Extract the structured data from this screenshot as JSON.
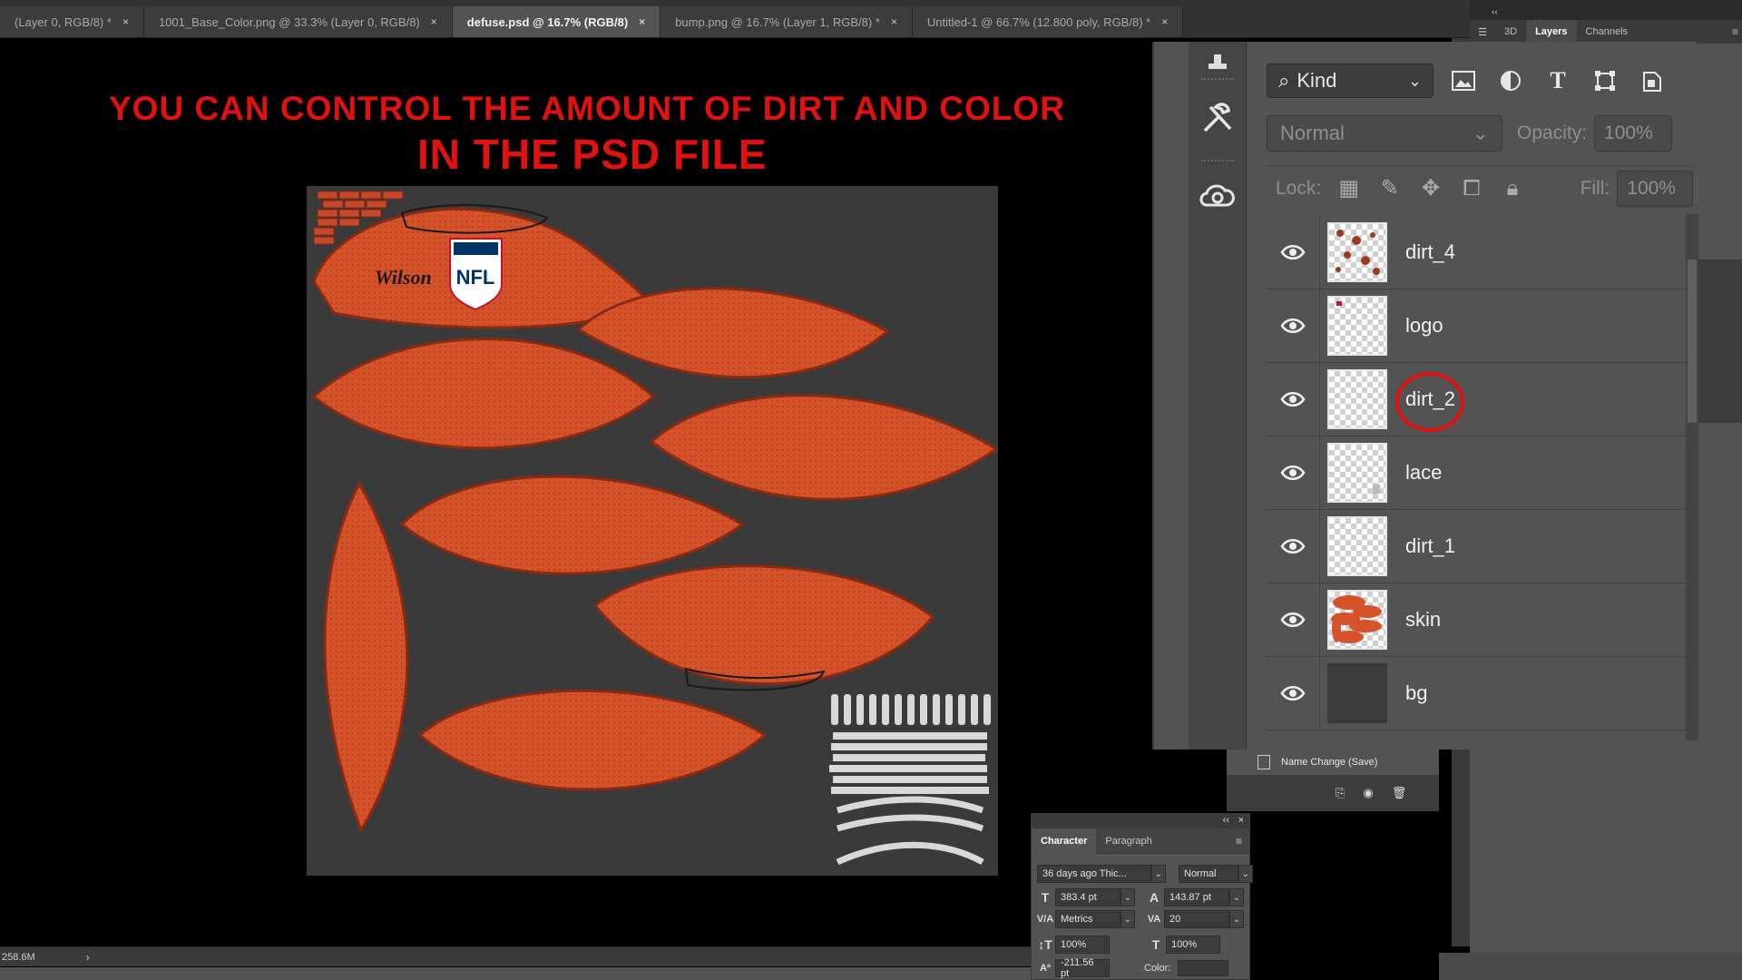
{
  "tabs": [
    {
      "label": "(Layer 0, RGB/8) *",
      "active": false
    },
    {
      "label": "1001_Base_Color.png @ 33.3% (Layer 0, RGB/8)",
      "active": false
    },
    {
      "label": "defuse.psd @ 16.7% (RGB/8)",
      "active": true
    },
    {
      "label": "bump.png @ 16.7% (Layer 1, RGB/8) *",
      "active": false
    },
    {
      "label": "Untitled-1 @ 66.7% (12.800 poly, RGB/8) *",
      "active": false
    }
  ],
  "tab_close": "×",
  "headline": {
    "line1": "YOU CAN CONTROL THE AMOUNT OF DIRT AND COLOR",
    "line2": "IN THE PSD FILE"
  },
  "canvas_logo": {
    "brand": "Wilson",
    "league": "NFL"
  },
  "panel_tabs": {
    "tab_3d": "3D",
    "tab_layers": "Layers",
    "tab_channels": "Channels",
    "collapse": "‹‹"
  },
  "layers_panel": {
    "kind_label": "Kind",
    "blend_mode": "Normal",
    "opacity_label": "Opacity:",
    "opacity_value": "100%",
    "lock_label": "Lock:",
    "fill_label": "Fill:",
    "fill_value": "100%",
    "layers": [
      {
        "name": "dirt_4"
      },
      {
        "name": "logo"
      },
      {
        "name": "dirt_2",
        "highlighted": true
      },
      {
        "name": "lace"
      },
      {
        "name": "dirt_1"
      },
      {
        "name": "skin"
      },
      {
        "name": "bg"
      }
    ]
  },
  "history": {
    "state": "Name Change (Save)"
  },
  "character_panel": {
    "tab_character": "Character",
    "tab_paragraph": "Paragraph",
    "font_family": "36 days ago Thic...",
    "font_style": "Normal",
    "font_size": "383.4 pt",
    "leading": "143.87 pt",
    "kerning": "Metrics",
    "tracking": "20",
    "vertical_scale": "100%",
    "horizontal_scale": "100%",
    "baseline_shift": "-211.56 pt",
    "color_label": "Color:"
  },
  "status": {
    "doc_size": "258.6M",
    "arrow": "›"
  },
  "colors": {
    "accent_red": "#e01111",
    "leather": "#d4532a",
    "canvas_bg": "#3a3a3a"
  }
}
